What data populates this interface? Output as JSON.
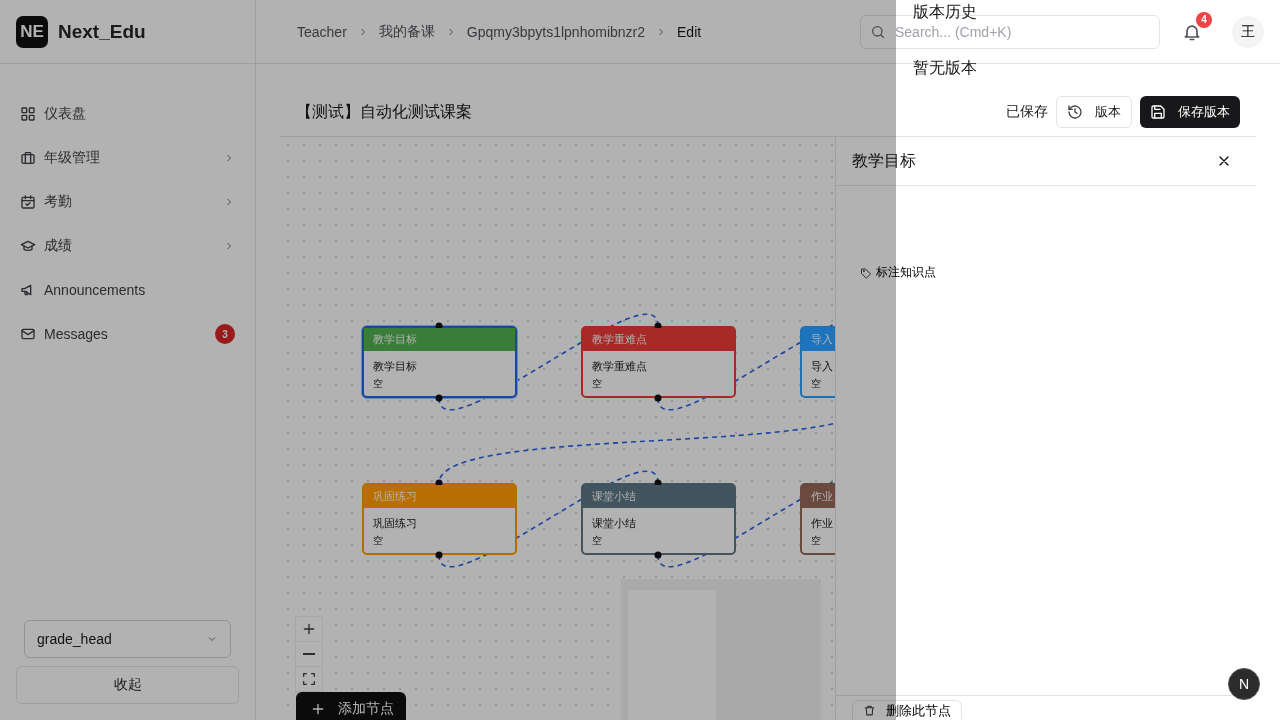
{
  "app": {
    "logo": "NE",
    "name": "Next_Edu"
  },
  "sidebar": {
    "items": [
      {
        "label": "仪表盘",
        "has_submenu": false
      },
      {
        "label": "年级管理",
        "has_submenu": true
      },
      {
        "label": "考勤",
        "has_submenu": true
      },
      {
        "label": "成绩",
        "has_submenu": true
      },
      {
        "label": "Announcements",
        "has_submenu": false
      },
      {
        "label": "Messages",
        "has_submenu": false,
        "badge": "3"
      }
    ],
    "role_select": {
      "value": "grade_head"
    },
    "collapse_button": "收起"
  },
  "header": {
    "breadcrumb": [
      "Teacher",
      "我的备课",
      "Gpqmy3bpyts1lpnhomibnzr2",
      "Edit"
    ],
    "search": {
      "placeholder": "Search... (Cmd+K)"
    },
    "notifications": {
      "badge": "4"
    },
    "avatar": "王"
  },
  "lesson": {
    "title": "【测试】自动化测试课案",
    "save_status": "已保存",
    "version_button": "版本",
    "save_button": "保存版本"
  },
  "canvas": {
    "nodes": [
      {
        "header": "教学目标",
        "title": "教学目标",
        "content": "空",
        "color": "#3a7d3a",
        "selected": true
      },
      {
        "header": "教学重难点",
        "title": "教学重难点",
        "content": "空",
        "color": "#a82a28",
        "selected": false
      },
      {
        "header": "导入",
        "title": "导入",
        "content": "空",
        "color": "#1e73bd",
        "selected": false
      },
      {
        "header": "巩固练习",
        "title": "巩固练习",
        "content": "空",
        "color": "#b86e00",
        "selected": false
      },
      {
        "header": "课堂小结",
        "title": "课堂小结",
        "content": "空",
        "color": "#42555e",
        "selected": false
      },
      {
        "header": "作业",
        "title": "作业",
        "content": "空",
        "color": "#6a4a3e",
        "selected": false
      }
    ],
    "add_node_button": "添加节点"
  },
  "panel": {
    "title": "教学目标",
    "tag_button": "标注知识点",
    "delete_button": "删除此节点"
  },
  "version_drawer": {
    "title": "版本历史",
    "empty_text": "暂无版本"
  },
  "dev_badge": "N"
}
